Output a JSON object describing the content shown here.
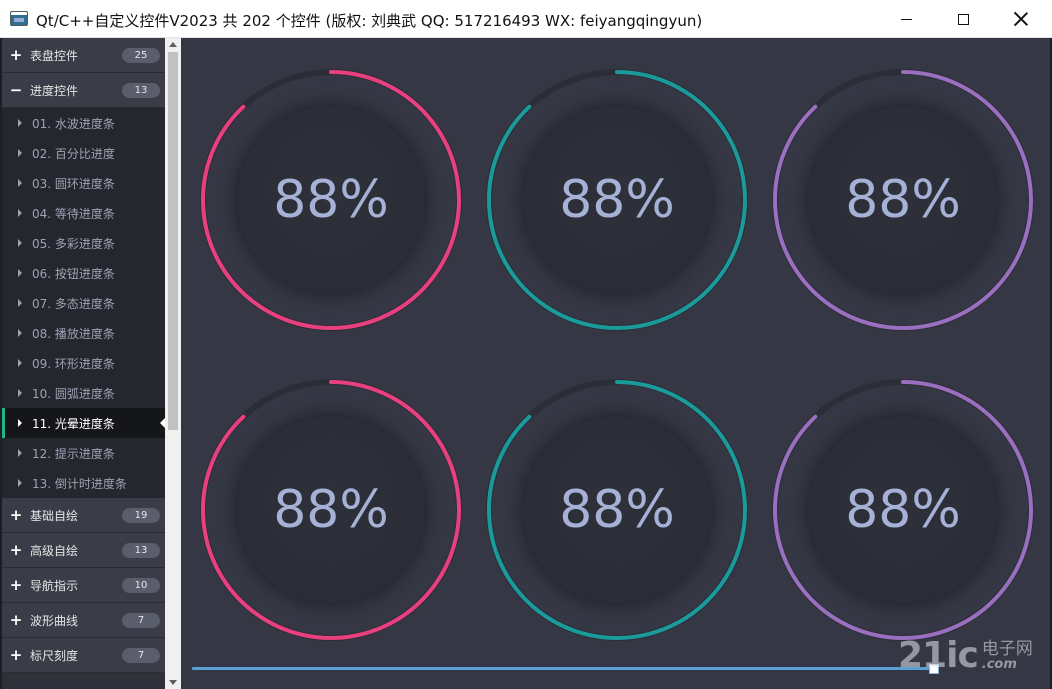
{
  "window": {
    "title": "Qt/C++自定义控件V2023 共 202 个控件 (版权: 刘典武 QQ: 517216493 WX: feiyangqingyun)"
  },
  "sidebar": {
    "groups_top": [
      {
        "sign": "+",
        "label": "表盘控件",
        "count": "25"
      },
      {
        "sign": "−",
        "label": "进度控件",
        "count": "13"
      }
    ],
    "children": [
      {
        "label": "01. 水波进度条"
      },
      {
        "label": "02. 百分比进度"
      },
      {
        "label": "03. 圆环进度条"
      },
      {
        "label": "04. 等待进度条"
      },
      {
        "label": "05. 多彩进度条"
      },
      {
        "label": "06. 按钮进度条"
      },
      {
        "label": "07. 多态进度条"
      },
      {
        "label": "08. 播放进度条"
      },
      {
        "label": "09. 环形进度条"
      },
      {
        "label": "10. 圆弧进度条"
      },
      {
        "label": "11. 光晕进度条"
      },
      {
        "label": "12. 提示进度条"
      },
      {
        "label": "13. 倒计时进度条"
      }
    ],
    "active_child_index": 10,
    "groups_bottom": [
      {
        "sign": "+",
        "label": "基础自绘",
        "count": "19"
      },
      {
        "sign": "+",
        "label": "高级自绘",
        "count": "13"
      },
      {
        "sign": "+",
        "label": "导航指示",
        "count": "10"
      },
      {
        "sign": "+",
        "label": "波形曲线",
        "count": "7"
      },
      {
        "sign": "+",
        "label": "标尺刻度",
        "count": "7"
      }
    ]
  },
  "gauges": [
    {
      "value_text": "88%",
      "value": 88,
      "color": "#e8407f"
    },
    {
      "value_text": "88%",
      "value": 88,
      "color": "#1a9a9a"
    },
    {
      "value_text": "88%",
      "value": 88,
      "color": "#9b6fbf"
    },
    {
      "value_text": "88%",
      "value": 88,
      "color": "#e8407f"
    },
    {
      "value_text": "88%",
      "value": 88,
      "color": "#1a9a9a"
    },
    {
      "value_text": "88%",
      "value": 88,
      "color": "#9b6fbf"
    }
  ],
  "watermark": {
    "main": "21ic",
    "cn": "电子网",
    "sub": ".com"
  }
}
